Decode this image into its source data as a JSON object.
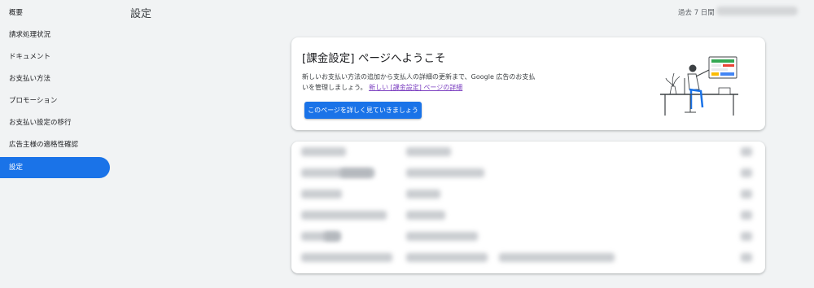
{
  "sidebar": {
    "items": [
      {
        "label": "概要"
      },
      {
        "label": "請求処理状況"
      },
      {
        "label": "ドキュメント"
      },
      {
        "label": "お支払い方法"
      },
      {
        "label": "プロモーション"
      },
      {
        "label": "お支払い設定の移行"
      },
      {
        "label": "広告主様の適格性確認"
      },
      {
        "label": "設定"
      }
    ],
    "active_index": 7
  },
  "header": {
    "title": "設定",
    "period": "過去 7 日間"
  },
  "welcome": {
    "title": "[課金設定] ページへようこそ",
    "description": "新しいお支払い方法の追加から支払人の詳細の更新まで、Google 広告のお支払いを管理しましょう。",
    "link": "新しい [課金設定] ページの詳細",
    "button": "このページを詳しく見ていきましょう"
  },
  "colors": {
    "accent": "#1a73e8",
    "link": "#7b3fc0",
    "background": "#f1f3f4"
  }
}
